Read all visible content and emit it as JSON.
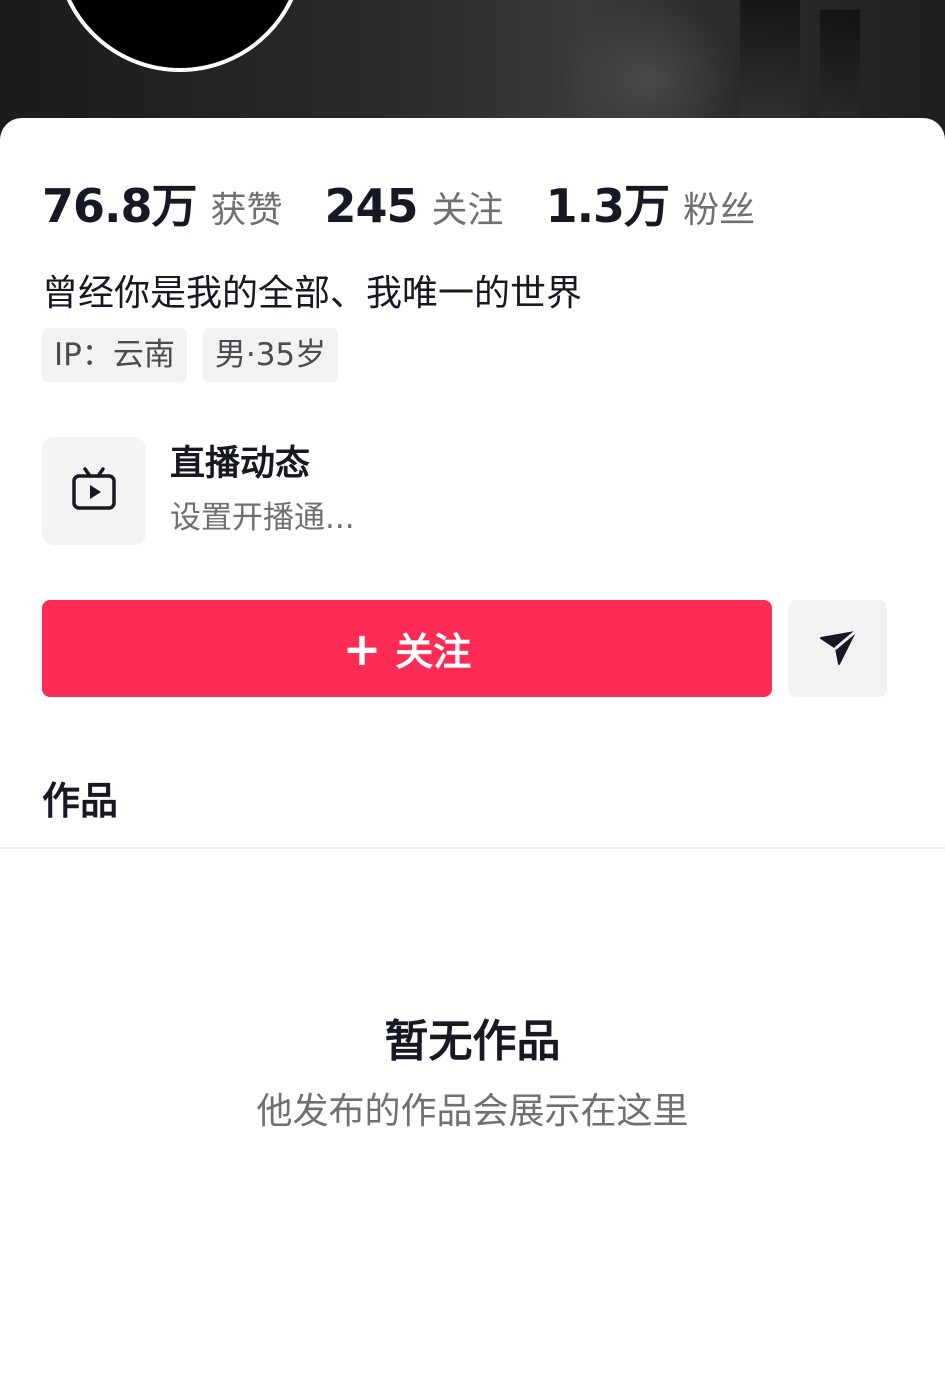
{
  "profile": {
    "stats": [
      {
        "value": "76.8万",
        "label": "获赞"
      },
      {
        "value": "245",
        "label": "关注"
      },
      {
        "value": "1.3万",
        "label": "粉丝"
      }
    ],
    "bio": "曾经你是我的全部、我唯一的世界",
    "tags": [
      "IP：云南",
      "男·35岁"
    ]
  },
  "live": {
    "icon": "tv-play-icon",
    "title": "直播动态",
    "subtitle": "设置开播通..."
  },
  "actions": {
    "follow_plus": "+",
    "follow_label": "关注",
    "share_icon": "send-arrow-icon"
  },
  "tabs": {
    "works_label": "作品"
  },
  "empty_state": {
    "title": "暂无作品",
    "subtitle": "他发布的作品会展示在这里"
  },
  "colors": {
    "accent": "#fe2c55",
    "text_primary": "#161823",
    "text_secondary": "#6f6f74",
    "chip_bg": "#f2f2f2"
  }
}
